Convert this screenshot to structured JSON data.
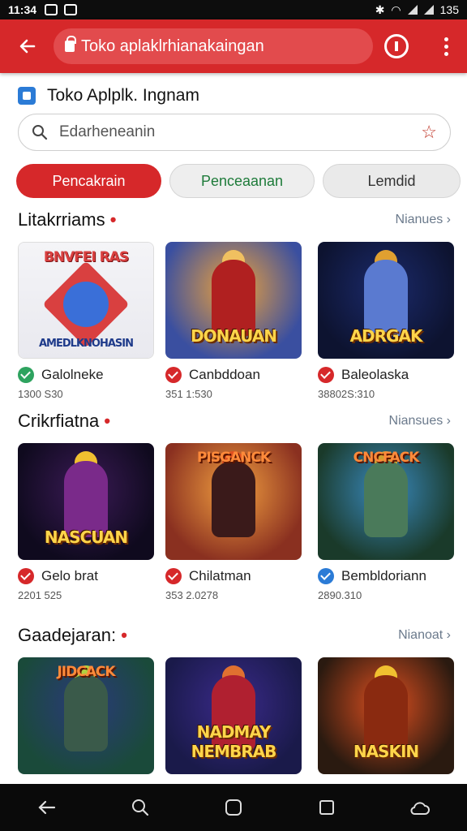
{
  "status_bar": {
    "time": "11:34",
    "right_text": "135"
  },
  "toolbar": {
    "url": "Toko aplaklrhianakaingan"
  },
  "app": {
    "title": "Toko Aplplk. Ingnam"
  },
  "search": {
    "value": "Edarheneanin"
  },
  "chips": [
    {
      "label": "Pencakrain"
    },
    {
      "label": "Penceaanan"
    },
    {
      "label": "Lemdid"
    }
  ],
  "sections": [
    {
      "title": "Litakrriams",
      "more": "Nianues",
      "cards": [
        {
          "name": "Galolneke",
          "meta": "1300 S30",
          "badge_color": "#2ea35f",
          "top_text": "BNVFEI RAS",
          "logo_text": "AMEDLKNOHASIN"
        },
        {
          "name": "Canbddoan",
          "meta": "351 1:530",
          "badge_color": "#d6282a",
          "top_text": "",
          "logo_text": "DONAUAN"
        },
        {
          "name": "Baleolaska",
          "meta": "38802S:310",
          "badge_color": "#d6282a",
          "top_text": "",
          "logo_text": "ADRGAK"
        }
      ]
    },
    {
      "title": "Crikrfiatna",
      "more": "Niansues",
      "cards": [
        {
          "name": "Gelo brat",
          "meta": "2201 525",
          "badge_color": "#d6282a",
          "top_text": "",
          "logo_text": "NASCUAN"
        },
        {
          "name": "Chilatman",
          "meta": "353 2.0278",
          "badge_color": "#d6282a",
          "top_text": "PISGANCK",
          "logo_text": ""
        },
        {
          "name": "Bembldoriann",
          "meta": "2890.310",
          "badge_color": "#2b7bd6",
          "top_text": "CNCFACK",
          "logo_text": ""
        }
      ]
    },
    {
      "title": "Gaadejaran:",
      "more": "Nianoat",
      "cards": [
        {
          "name": "",
          "meta": "",
          "badge_color": "",
          "top_text": "JIDCACK",
          "logo_text": ""
        },
        {
          "name": "",
          "meta": "",
          "badge_color": "",
          "top_text": "",
          "logo_text": "NADMAY NEMBRAB"
        },
        {
          "name": "",
          "meta": "",
          "badge_color": "",
          "top_text": "",
          "logo_text": "NASKIN"
        }
      ]
    }
  ],
  "colors": {
    "accent": "#d6282a",
    "toolbar": "#d6282a",
    "navbar": "#0a0a0a"
  },
  "icons": [
    "back-arrow-icon",
    "lock-icon",
    "info-icon",
    "more-vert-icon",
    "search-icon",
    "star-icon",
    "chevron-right-icon",
    "nav-back-icon",
    "nav-search-icon",
    "nav-home-icon",
    "nav-recents-icon",
    "nav-cloud-icon"
  ]
}
